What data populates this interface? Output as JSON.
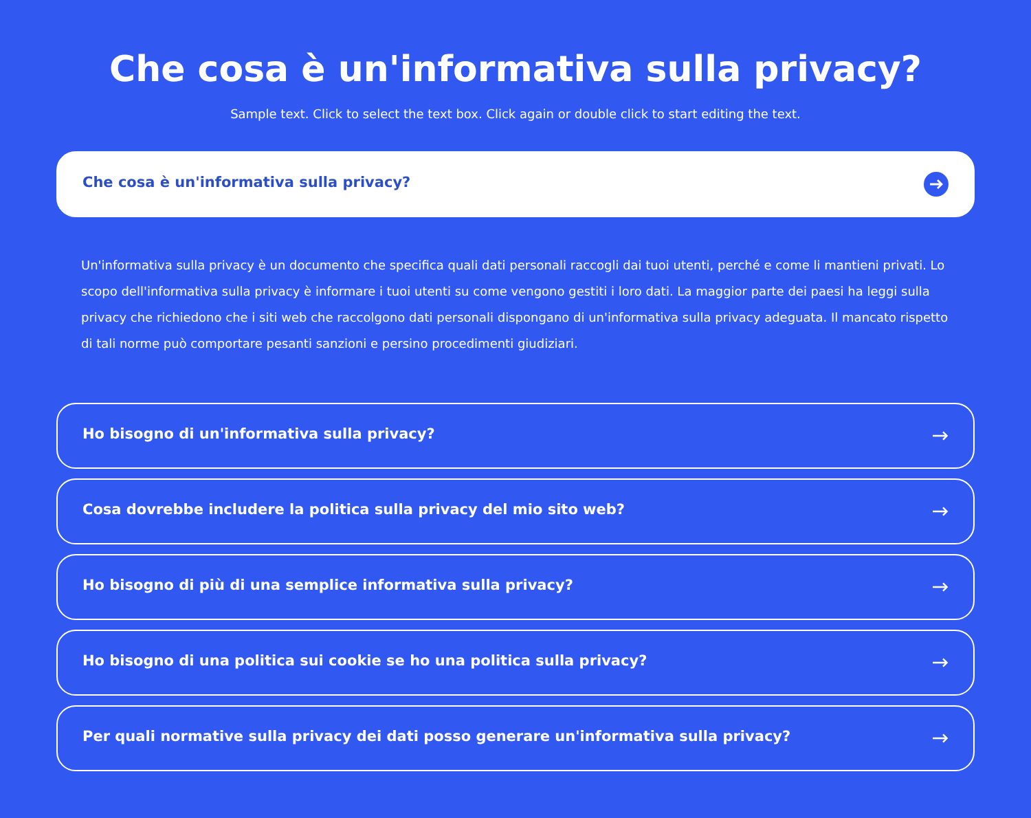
{
  "title": "Che cosa è un'informativa sulla privacy?",
  "subtitle": "Sample text. Click to select the text box. Click again or double click to start editing the text.",
  "faq": [
    {
      "question": "Che cosa è un'informativa sulla privacy?",
      "expanded": true,
      "answer": "Un'informativa sulla privacy è un documento che specifica quali dati personali raccogli dai tuoi utenti, perché e come li mantieni privati. Lo scopo dell'informativa sulla privacy è informare i tuoi utenti su come vengono gestiti i loro dati. La maggior parte dei paesi ha leggi sulla privacy che richiedono che i siti web che raccolgono dati personali dispongano di un'informativa sulla privacy adeguata. Il mancato rispetto di tali norme può comportare pesanti sanzioni e persino procedimenti giudiziari."
    },
    {
      "question": "Ho bisogno di un'informativa sulla privacy?",
      "expanded": false
    },
    {
      "question": "Cosa dovrebbe includere la politica sulla privacy del mio sito web?",
      "expanded": false
    },
    {
      "question": "Ho bisogno di più di una semplice informativa sulla privacy?",
      "expanded": false
    },
    {
      "question": "Ho bisogno di una politica sui cookie se ho una politica sulla privacy?",
      "expanded": false
    },
    {
      "question": "Per quali normative sulla privacy dei dati posso generare un'informativa sulla privacy?",
      "expanded": false
    }
  ]
}
